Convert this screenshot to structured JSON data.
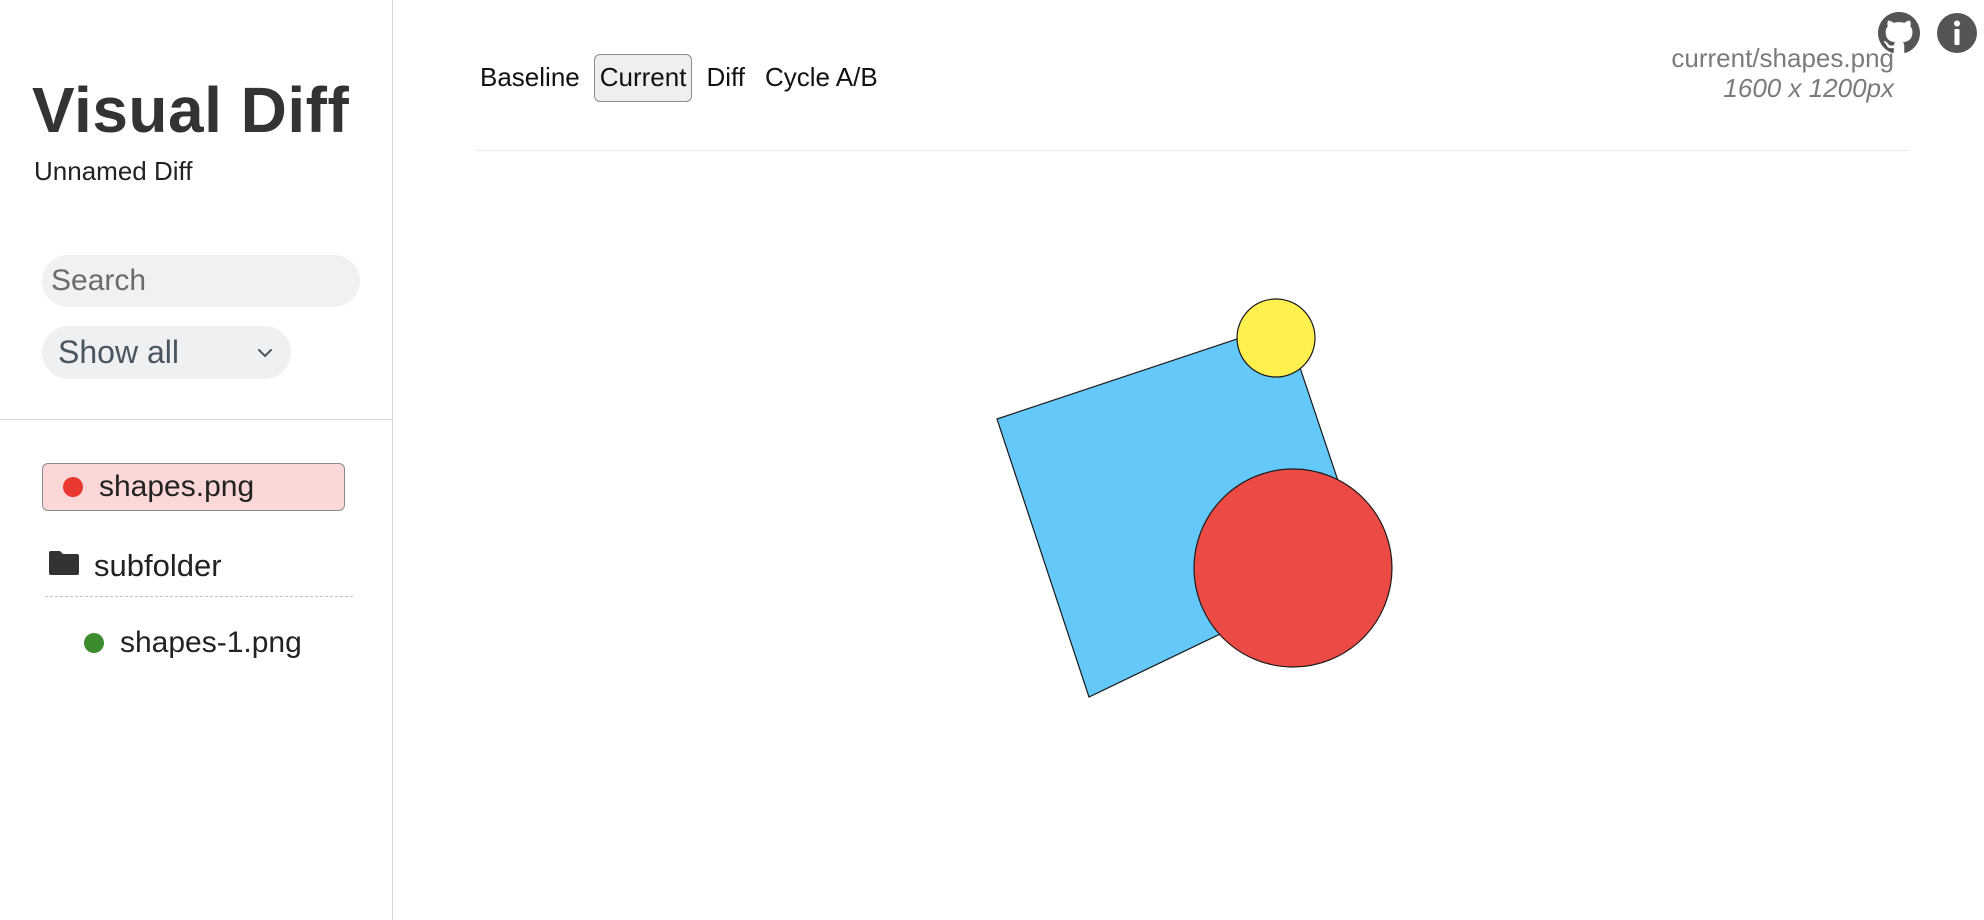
{
  "app": {
    "title": "Visual Diff",
    "subtitle": "Unnamed Diff"
  },
  "sidebar": {
    "search_placeholder": "Search",
    "search_value": "",
    "filter_selected": "Show all",
    "files": [
      {
        "name": "shapes.png",
        "status_color": "#e8382f",
        "selected": true
      }
    ],
    "folders": [
      {
        "name": "subfolder",
        "files": [
          {
            "name": "shapes-1.png",
            "status_color": "#3d8b2f"
          }
        ]
      }
    ]
  },
  "toolbar": {
    "tabs": [
      {
        "label": "Baseline",
        "active": false
      },
      {
        "label": "Current",
        "active": true
      },
      {
        "label": "Diff",
        "active": false
      },
      {
        "label": "Cycle A/B",
        "active": false
      }
    ],
    "file_path": "current/shapes.png",
    "file_dims": "1600 x 1200px"
  },
  "header_icons": [
    "github-icon",
    "info-icon"
  ],
  "image": {
    "shapes": [
      {
        "type": "rotated-square",
        "fill": "#64c8f8",
        "stroke": "#1a1a1a"
      },
      {
        "type": "circle",
        "fill": "#ffef4f",
        "stroke": "#1a1a1a"
      },
      {
        "type": "circle",
        "fill": "#eb4a45",
        "stroke": "#1a1a1a"
      }
    ]
  },
  "colors": {
    "selected_bg": "#fbd7d7",
    "changed": "#e8382f",
    "unchanged": "#3d8b2f"
  }
}
